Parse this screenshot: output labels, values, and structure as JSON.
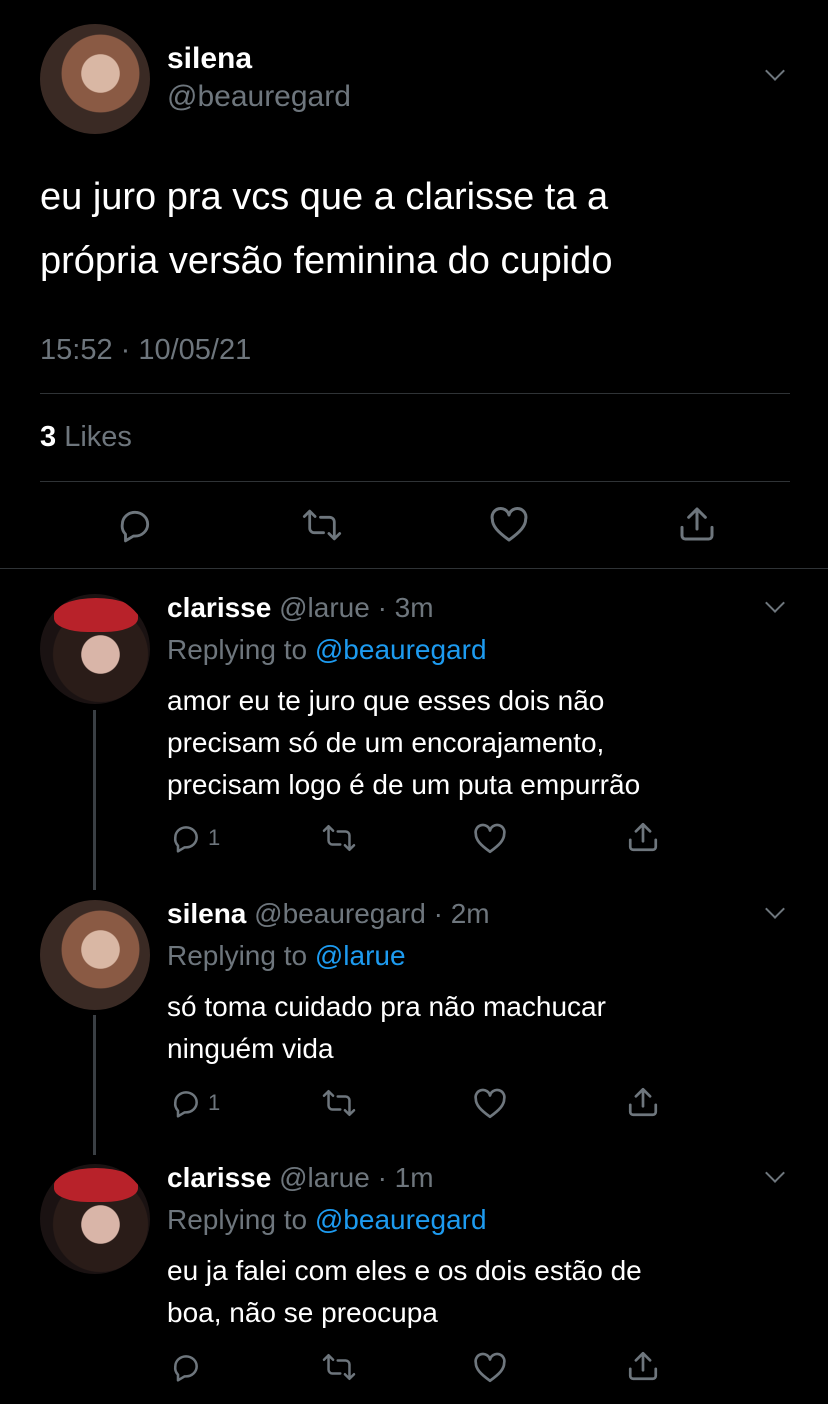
{
  "main_tweet": {
    "display_name": "silena",
    "handle": "@beauregard",
    "text_line1": "eu juro pra vcs que a clarisse ta a",
    "text_line2": "própria versão feminina do cupido",
    "timestamp": "15:52 · 10/05/21",
    "likes_count": "3",
    "likes_label": "Likes",
    "avatar_icon": "avatar-silena"
  },
  "replies": [
    {
      "display_name": "clarisse",
      "handle": "@larue",
      "time": "· 3m",
      "replying_label": "Replying to",
      "replying_to": "@beauregard",
      "text_line1": "amor eu te juro que esses dois não",
      "text_line2": "precisam só de um encorajamento,",
      "text_line3": "precisam logo é de um puta empurrão",
      "reply_count": "1"
    },
    {
      "display_name": "silena",
      "handle": "@beauregard",
      "time": "· 2m",
      "replying_label": "Replying to",
      "replying_to": "@larue",
      "text_line1": "só toma cuidado pra não machucar",
      "text_line2": "ninguém vida",
      "reply_count": "1"
    },
    {
      "display_name": "clarisse",
      "handle": "@larue",
      "time": "· 1m",
      "replying_label": "Replying to",
      "replying_to": "@beauregard",
      "text_line1": "eu ja falei com eles e os dois estão de",
      "text_line2": "boa, não se preocupa"
    }
  ],
  "colors": {
    "background": "#000000",
    "muted": "#6e767d",
    "link": "#1d9bf0",
    "divider": "#2f3336"
  },
  "icons": [
    "reply-icon",
    "retweet-icon",
    "like-icon",
    "share-icon",
    "chevron-down-icon"
  ]
}
